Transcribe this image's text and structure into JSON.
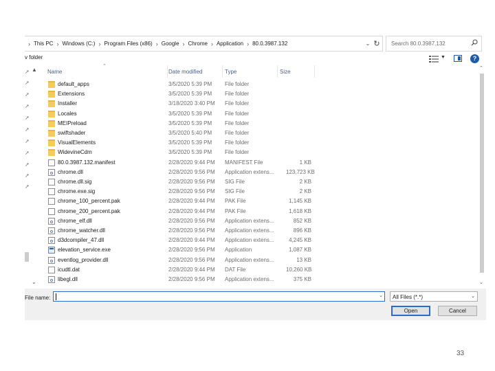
{
  "breadcrumbs": [
    "This PC",
    "Windows (C:)",
    "Program Files (x86)",
    "Google",
    "Chrome",
    "Application",
    "80.0.3987.132"
  ],
  "search": {
    "placeholder": "Search 80.0.3987.132"
  },
  "toolbar": {
    "new_folder": "v folder",
    "help": "?"
  },
  "columns": {
    "name": "Name",
    "date": "Date modified",
    "type": "Type",
    "size": "Size"
  },
  "files": [
    {
      "name": "default_apps",
      "date": "3/5/2020 5:39 PM",
      "type": "File folder",
      "size": "",
      "icon": "folder-icon"
    },
    {
      "name": "Extensions",
      "date": "3/5/2020 5:39 PM",
      "type": "File folder",
      "size": "",
      "icon": "folder-icon"
    },
    {
      "name": "Installer",
      "date": "3/18/2020 3:40 PM",
      "type": "File folder",
      "size": "",
      "icon": "folder-icon"
    },
    {
      "name": "Locales",
      "date": "3/5/2020 5:39 PM",
      "type": "File folder",
      "size": "",
      "icon": "folder-icon"
    },
    {
      "name": "MEIPreload",
      "date": "3/5/2020 5:39 PM",
      "type": "File folder",
      "size": "",
      "icon": "folder-icon"
    },
    {
      "name": "swiftshader",
      "date": "3/5/2020 5:40 PM",
      "type": "File folder",
      "size": "",
      "icon": "folder-icon"
    },
    {
      "name": "VisualElements",
      "date": "3/5/2020 5:39 PM",
      "type": "File folder",
      "size": "",
      "icon": "folder-icon"
    },
    {
      "name": "WidevineCdm",
      "date": "3/5/2020 5:39 PM",
      "type": "File folder",
      "size": "",
      "icon": "folder-icon"
    },
    {
      "name": "80.0.3987.132.manifest",
      "date": "2/28/2020 9:44 PM",
      "type": "MANIFEST File",
      "size": "1 KB",
      "icon": "file-icon"
    },
    {
      "name": "chrome.dll",
      "date": "2/28/2020 9:56 PM",
      "type": "Application extens...",
      "size": "123,723 KB",
      "icon": "dll-icon"
    },
    {
      "name": "chrome.dll.sig",
      "date": "2/28/2020 9:56 PM",
      "type": "SIG File",
      "size": "2 KB",
      "icon": "file-icon"
    },
    {
      "name": "chrome.exe.sig",
      "date": "2/28/2020 9:56 PM",
      "type": "SIG File",
      "size": "2 KB",
      "icon": "file-icon"
    },
    {
      "name": "chrome_100_percent.pak",
      "date": "2/28/2020 9:44 PM",
      "type": "PAK File",
      "size": "1,145 KB",
      "icon": "file-icon"
    },
    {
      "name": "chrome_200_percent.pak",
      "date": "2/28/2020 9:44 PM",
      "type": "PAK File",
      "size": "1,618 KB",
      "icon": "file-icon"
    },
    {
      "name": "chrome_elf.dll",
      "date": "2/28/2020 9:56 PM",
      "type": "Application extens...",
      "size": "852 KB",
      "icon": "dll-icon"
    },
    {
      "name": "chrome_watcher.dll",
      "date": "2/28/2020 9:56 PM",
      "type": "Application extens...",
      "size": "896 KB",
      "icon": "dll-icon"
    },
    {
      "name": "d3dcompiler_47.dll",
      "date": "2/28/2020 9:44 PM",
      "type": "Application extens...",
      "size": "4,245 KB",
      "icon": "dll-icon"
    },
    {
      "name": "elevation_service.exe",
      "date": "2/28/2020 9:56 PM",
      "type": "Application",
      "size": "1,087 KB",
      "icon": "exe-icon"
    },
    {
      "name": "eventlog_provider.dll",
      "date": "2/28/2020 9:56 PM",
      "type": "Application extens...",
      "size": "13 KB",
      "icon": "dll-icon"
    },
    {
      "name": "icudtl.dat",
      "date": "2/28/2020 9:44 PM",
      "type": "DAT File",
      "size": "10,260 KB",
      "icon": "file-icon"
    },
    {
      "name": "libegl.dll",
      "date": "2/28/2020 9:56 PM",
      "type": "Application extens...",
      "size": "375 KB",
      "icon": "dll-icon"
    }
  ],
  "filename": {
    "label": "File name:",
    "value": ""
  },
  "filter": {
    "selected": "All Files (*.*)"
  },
  "buttons": {
    "open": "Open",
    "cancel": "Cancel"
  },
  "page_number": "33",
  "colors": {
    "accent": "#2c6ac6",
    "folder": "#f4cc5b"
  }
}
